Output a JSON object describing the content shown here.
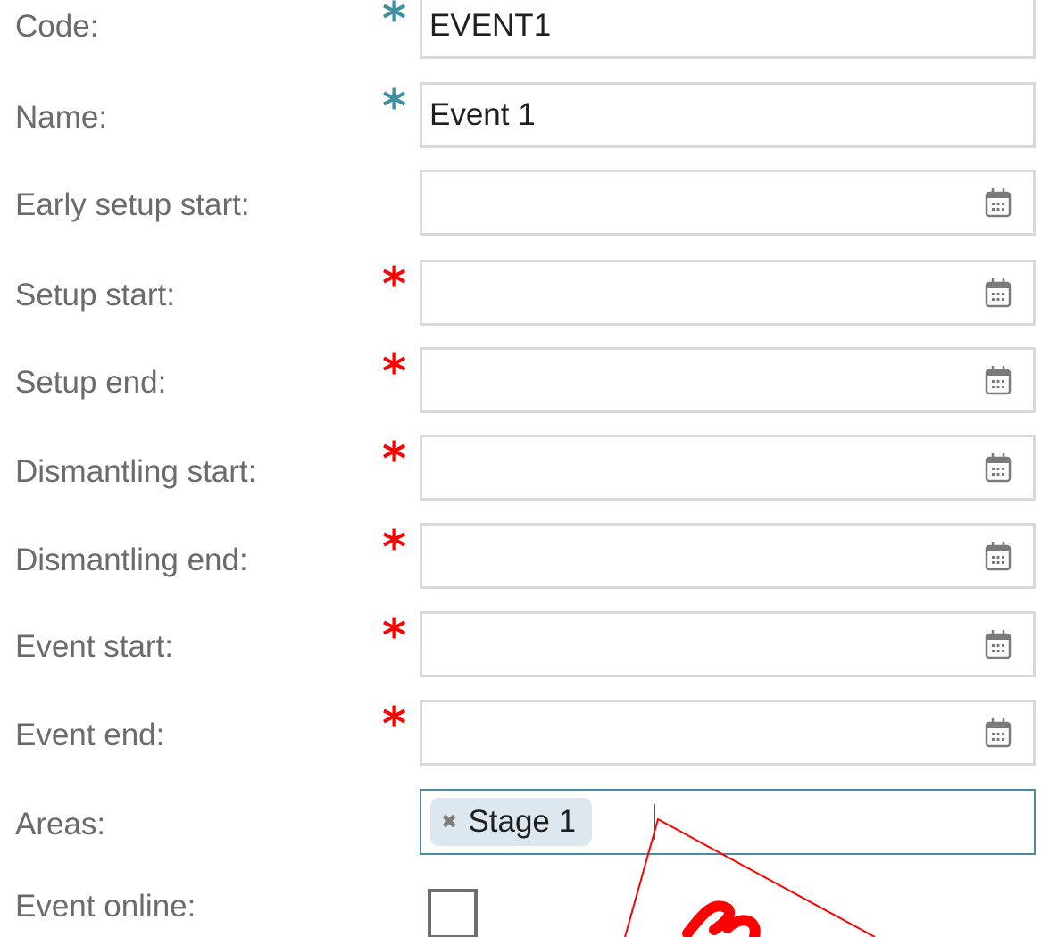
{
  "form": {
    "code": {
      "label": "Code:",
      "value": "EVENT1"
    },
    "name": {
      "label": "Name:",
      "value": "Event 1"
    },
    "early_setup_start": {
      "label": "Early setup start:",
      "value": ""
    },
    "setup_start": {
      "label": "Setup start:",
      "value": ""
    },
    "setup_end": {
      "label": "Setup end:",
      "value": ""
    },
    "dismantling_start": {
      "label": "Dismantling start:",
      "value": ""
    },
    "dismantling_end": {
      "label": "Dismantling end:",
      "value": ""
    },
    "event_start": {
      "label": "Event start:",
      "value": ""
    },
    "event_end": {
      "label": "Event end:",
      "value": ""
    },
    "areas": {
      "label": "Areas:",
      "tags": [
        "Stage 1"
      ],
      "remove_symbol": "✖"
    },
    "event_online": {
      "label": "Event online:",
      "checked": false
    },
    "required_marker": "*"
  },
  "colors": {
    "required_filled": "#3f8ea1",
    "required_empty": "#ff0000",
    "label": "#6b6b6b",
    "stamp": "#ff0000"
  },
  "icons": {
    "date_picker": "calendar-icon",
    "tag_remove": "close-icon"
  }
}
